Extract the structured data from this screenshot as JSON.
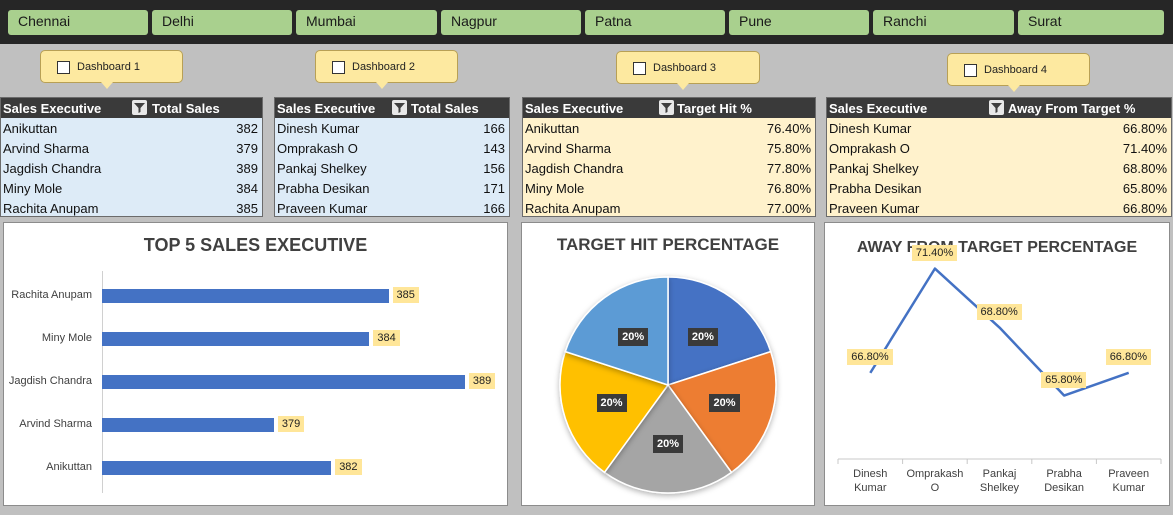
{
  "slicer": {
    "cities": [
      "Chennai",
      "Delhi",
      "Mumbai",
      "Nagpur",
      "Patna",
      "Pune",
      "Ranchi",
      "Surat"
    ]
  },
  "dashboards": [
    "Dashboard 1",
    "Dashboard 2",
    "Dashboard 3",
    "Dashboard 4"
  ],
  "tables": [
    {
      "col1": "Sales Executive",
      "col2": "Total Sales",
      "rows": [
        {
          "name": "Anikuttan",
          "value": "382"
        },
        {
          "name": "Arvind Sharma",
          "value": "379"
        },
        {
          "name": "Jagdish Chandra",
          "value": "389"
        },
        {
          "name": "Miny Mole",
          "value": "384"
        },
        {
          "name": "Rachita Anupam",
          "value": "385"
        }
      ]
    },
    {
      "col1": "Sales Executive",
      "col2": "Total Sales",
      "rows": [
        {
          "name": "Dinesh Kumar",
          "value": "166"
        },
        {
          "name": "Omprakash O",
          "value": "143"
        },
        {
          "name": "Pankaj Shelkey",
          "value": "156"
        },
        {
          "name": "Prabha Desikan",
          "value": "171"
        },
        {
          "name": "Praveen Kumar",
          "value": "166"
        }
      ]
    },
    {
      "col1": "Sales Executive",
      "col2": "Target Hit %",
      "rows": [
        {
          "name": "Anikuttan",
          "value": "76.40%"
        },
        {
          "name": "Arvind Sharma",
          "value": "75.80%"
        },
        {
          "name": "Jagdish Chandra",
          "value": "77.80%"
        },
        {
          "name": "Miny Mole",
          "value": "76.80%"
        },
        {
          "name": "Rachita Anupam",
          "value": "77.00%"
        }
      ]
    },
    {
      "col1": "Sales Executive",
      "col2": "Away From Target %",
      "rows": [
        {
          "name": "Dinesh Kumar",
          "value": "66.80%"
        },
        {
          "name": "Omprakash O",
          "value": "71.40%"
        },
        {
          "name": "Pankaj Shelkey",
          "value": "68.80%"
        },
        {
          "name": "Prabha Desikan",
          "value": "65.80%"
        },
        {
          "name": "Praveen Kumar",
          "value": "66.80%"
        }
      ]
    }
  ],
  "colors": {
    "bar": "#4472c4",
    "pie": [
      "#4472c4",
      "#ed7d31",
      "#a5a5a5",
      "#ffc000",
      "#5b9bd5"
    ],
    "line": "#4472c4",
    "slicer": "#a9d08e"
  },
  "chart_data": [
    {
      "type": "bar",
      "title": "TOP 5 SALES EXECUTIVE",
      "orientation": "horizontal",
      "categories": [
        "Rachita Anupam",
        "Miny Mole",
        "Jagdish Chandra",
        "Arvind Sharma",
        "Anikuttan"
      ],
      "values": [
        385,
        384,
        389,
        379,
        382
      ],
      "value_labels": [
        "385",
        "384",
        "389",
        "379",
        "382"
      ],
      "xlim": [
        370,
        390
      ]
    },
    {
      "type": "pie",
      "title": "TARGET HIT PERCENTAGE",
      "values": [
        20,
        20,
        20,
        20,
        20
      ],
      "labels": [
        "20%",
        "20%",
        "20%",
        "20%",
        "20%"
      ]
    },
    {
      "type": "line",
      "title": "AWAY FROM TARGET PERCENTAGE",
      "categories": [
        "Dinesh Kumar",
        "Omprakash O",
        "Pankaj Shelkey",
        "Prabha Desikan",
        "Praveen Kumar"
      ],
      "category_lines": [
        [
          "Dinesh",
          "Kumar"
        ],
        [
          "Omprakash",
          "O"
        ],
        [
          "Pankaj",
          "Shelkey"
        ],
        [
          "Prabha",
          "Desikan"
        ],
        [
          "Praveen",
          "Kumar"
        ]
      ],
      "values": [
        66.8,
        71.4,
        68.8,
        65.8,
        66.8
      ],
      "value_labels": [
        "66.80%",
        "71.40%",
        "68.80%",
        "65.80%",
        "66.80%"
      ],
      "ylim": [
        63,
        72
      ]
    }
  ]
}
